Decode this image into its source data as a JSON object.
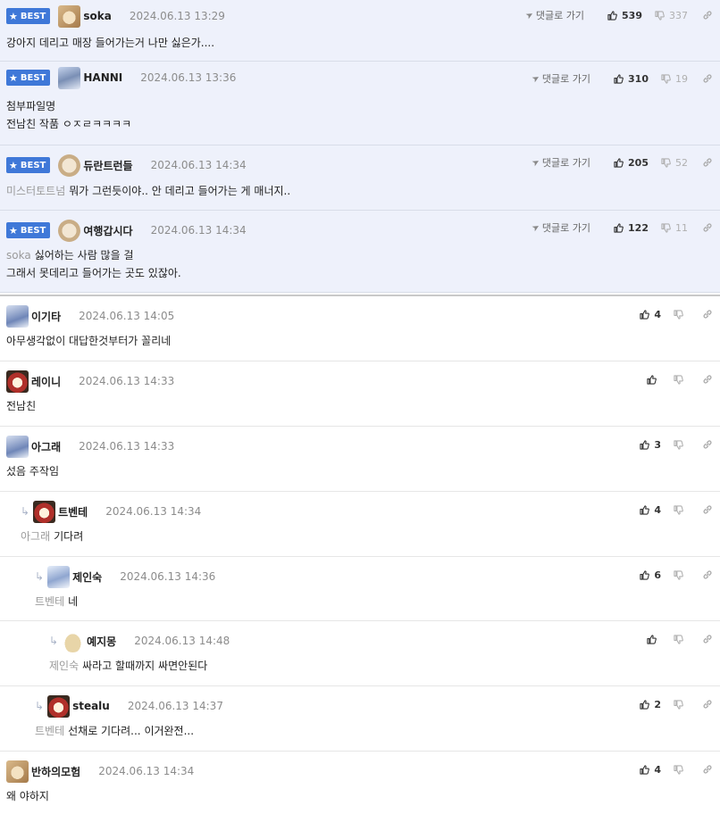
{
  "labels": {
    "best": "BEST",
    "reply_link": "댓글로 가기"
  },
  "colors": {
    "best_bg": "#eef1fb",
    "badge": "#3f78d8",
    "mention": "#9a9a9a"
  },
  "best_comments": [
    {
      "nick": "soka",
      "date": "2024.06.13 13:29",
      "likes": "539",
      "dislikes": "337",
      "mention": "",
      "text": "강아지 데리고 매장 들어가는거 나만 싫은가....",
      "avatar": "dog-icon"
    },
    {
      "nick": "HANNI",
      "date": "2024.06.13 13:36",
      "likes": "310",
      "dislikes": "19",
      "mention": "",
      "text": "첨부파일명\n전남친 작품 ㅇㅈㄹㅋㅋㅋㅋ",
      "avatar": "photo-icon"
    },
    {
      "nick": "듀란트런들",
      "date": "2024.06.13 14:34",
      "likes": "205",
      "dislikes": "52",
      "mention": "미스터토트넘",
      "text": "뭐가 그런듯이야.. 안 데리고 들어가는 게 매너지..",
      "avatar": "puppy-icon"
    },
    {
      "nick": "여행갑시다",
      "date": "2024.06.13 14:34",
      "likes": "122",
      "dislikes": "11",
      "mention": "soka",
      "text": "싫어하는 사람 많을 걸\n그래서 못데리고 들어가는 곳도 있잖아.",
      "avatar": "puppy-icon"
    }
  ],
  "comments": [
    {
      "nick": "이기타",
      "date": "2024.06.13 14:05",
      "likes": "4",
      "mention": "",
      "text": "아무생각없이 대답한것부터가 꼴리네",
      "depth": 0
    },
    {
      "nick": "레이니",
      "date": "2024.06.13 14:33",
      "likes": "",
      "mention": "",
      "text": "전남친",
      "depth": 0
    },
    {
      "nick": "아그래",
      "date": "2024.06.13 14:33",
      "likes": "3",
      "mention": "",
      "text": "섰음 주작임",
      "depth": 0
    },
    {
      "nick": "트벤테",
      "date": "2024.06.13 14:34",
      "likes": "4",
      "mention": "아그래",
      "text": "기다려",
      "depth": 1
    },
    {
      "nick": "제인숙",
      "date": "2024.06.13 14:36",
      "likes": "6",
      "mention": "트벤테",
      "text": "네",
      "depth": 2
    },
    {
      "nick": "예지몽",
      "date": "2024.06.13 14:48",
      "likes": "",
      "mention": "제인숙",
      "text": "싸라고 할때까지 싸면안된다",
      "depth": 3
    },
    {
      "nick": "stealu",
      "date": "2024.06.13 14:37",
      "likes": "2",
      "mention": "트벤테",
      "text": "선채로 기다려... 이거완전...",
      "depth": 2
    },
    {
      "nick": "반하의모험",
      "date": "2024.06.13 14:34",
      "likes": "4",
      "mention": "",
      "text": "왜 야하지",
      "depth": 0
    }
  ]
}
